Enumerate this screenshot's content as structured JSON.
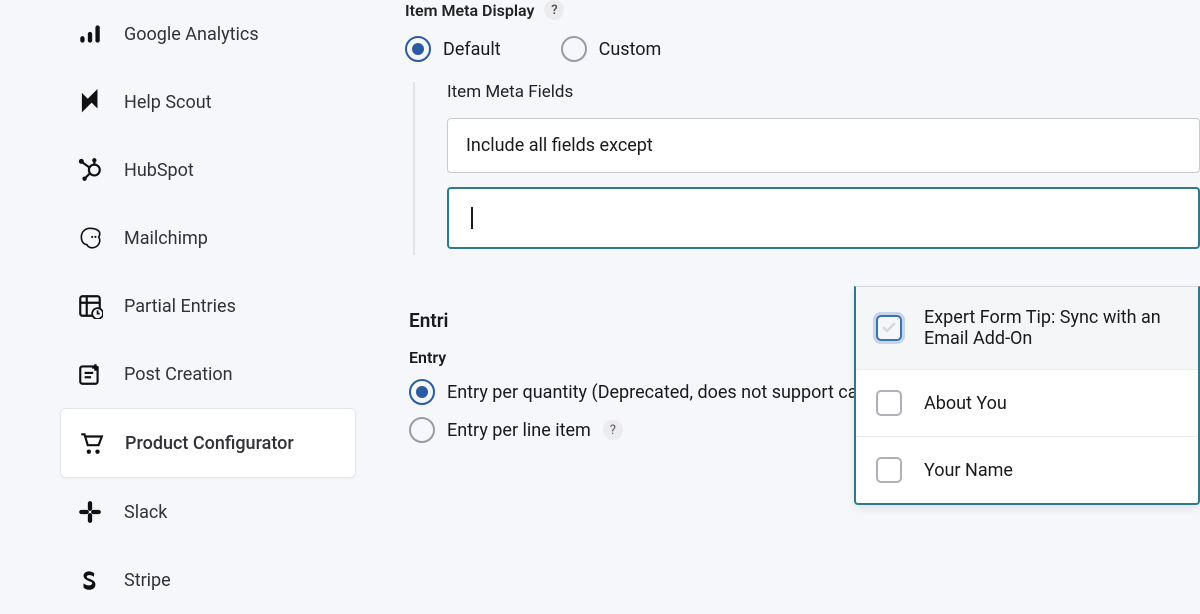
{
  "sidebar": {
    "items": [
      {
        "label": "Google Analytics",
        "icon": "analytics"
      },
      {
        "label": "Help Scout",
        "icon": "helpscout"
      },
      {
        "label": "HubSpot",
        "icon": "hubspot"
      },
      {
        "label": "Mailchimp",
        "icon": "mailchimp"
      },
      {
        "label": "Partial Entries",
        "icon": "partial"
      },
      {
        "label": "Post Creation",
        "icon": "postcreate"
      },
      {
        "label": "Product Configurator",
        "icon": "cart"
      },
      {
        "label": "Slack",
        "icon": "slack"
      },
      {
        "label": "Stripe",
        "icon": "stripe"
      }
    ],
    "active_index": 6
  },
  "main": {
    "item_meta_display": {
      "label": "Item Meta Display",
      "options": {
        "default": "Default",
        "custom": "Custom"
      },
      "selected": "default"
    },
    "item_meta_fields": {
      "label": "Item Meta Fields",
      "select_value": "Include all fields except",
      "search_value": "",
      "dropdown_options": [
        {
          "label": "Expert Form Tip: Sync with an Email Add-On",
          "focused": true
        },
        {
          "label": "About You",
          "focused": false
        },
        {
          "label": "Your Name",
          "focused": false
        }
      ]
    },
    "entries": {
      "header": "Entri",
      "creation_label": "Entry",
      "per_quantity": "Entry per quantity (Deprecated, does not support cart item editing)",
      "per_line_item": "Entry per line item",
      "selected": "per_quantity"
    }
  }
}
